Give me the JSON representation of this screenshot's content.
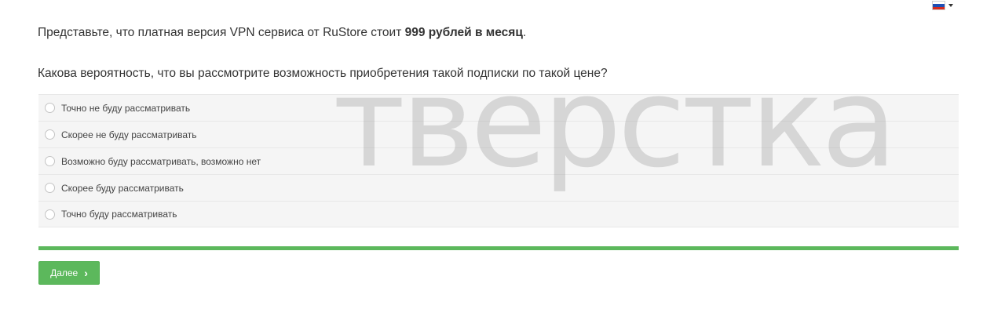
{
  "language": {
    "flag_icon": "russian-flag-icon",
    "caret_icon": "caret-down-icon"
  },
  "intro": {
    "before": "Представьте, что платная версия VPN сервиса от RuStore стоит ",
    "bold": "999 рублей в месяц",
    "after": "."
  },
  "question": "Какова вероятность, что вы рассмотрите возможность приобретения такой подписки по такой цене?",
  "options": [
    {
      "label": "Точно не буду рассматривать"
    },
    {
      "label": "Скорее не буду рассматривать"
    },
    {
      "label": "Возможно буду рассматривать, возможно нет"
    },
    {
      "label": "Скорее буду рассматривать"
    },
    {
      "label": "Точно буду рассматривать"
    }
  ],
  "progress": {
    "fraction": 1.0,
    "color": "#5cb85c"
  },
  "next_button": {
    "label": "Далее",
    "icon": "chevron-right-icon"
  },
  "watermark": "тверстка"
}
